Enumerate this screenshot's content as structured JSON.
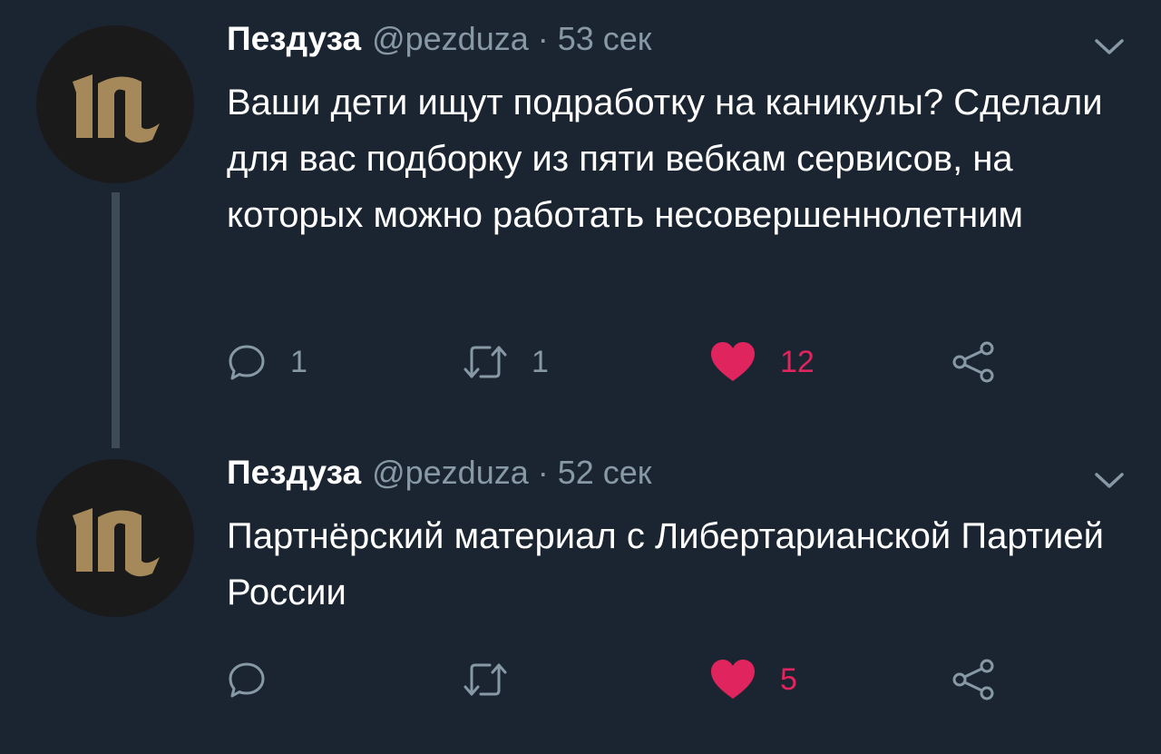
{
  "colors": {
    "background": "#1b2531",
    "text": "#ffffff",
    "muted": "#8899a6",
    "like": "#e0245e",
    "avatar_bg": "#1a1a1a",
    "avatar_logo": "#a6895a"
  },
  "tweets": [
    {
      "name": "Пездуза",
      "handle": "@pezduza",
      "separator": "·",
      "time": "53 сек",
      "text": "Ваши дети ищут подработку на каникулы? Сделали для вас подборку из пяти вебкам сервисов, на которых можно работать несовершеннолетним",
      "reply_count": "1",
      "retweet_count": "1",
      "like_count": "12",
      "icons": [
        "reply-icon",
        "retweet-icon",
        "heart-icon",
        "share-icon",
        "chevron-down-icon"
      ]
    },
    {
      "name": "Пездуза",
      "handle": "@pezduza",
      "separator": "·",
      "time": "52 сек",
      "text": "Партнёрский материал с Либертарианской Партией России",
      "reply_count": "",
      "retweet_count": "",
      "like_count": "5",
      "icons": [
        "reply-icon",
        "retweet-icon",
        "heart-icon",
        "share-icon",
        "chevron-down-icon"
      ]
    }
  ]
}
